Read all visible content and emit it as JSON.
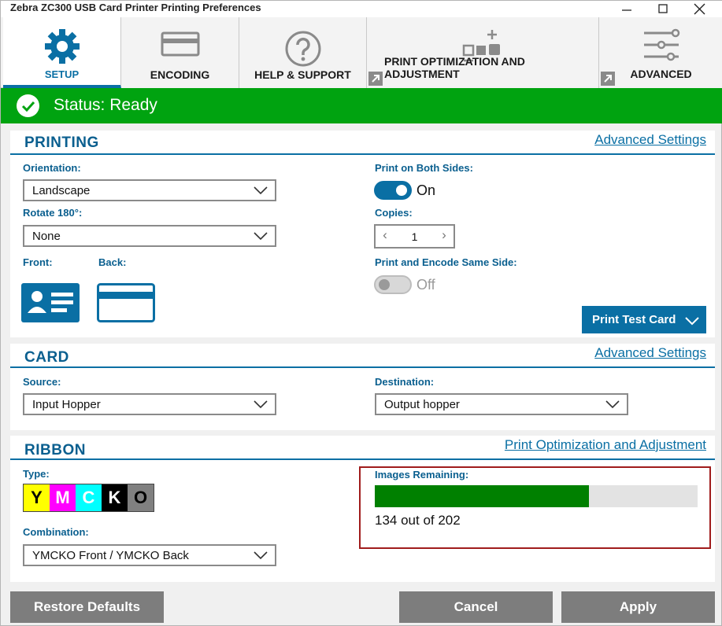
{
  "window": {
    "title": "Zebra ZC300 USB Card Printer Printing Preferences"
  },
  "tabs": [
    {
      "label": "SETUP",
      "icon": "gear-icon"
    },
    {
      "label": "ENCODING",
      "icon": "card-icon"
    },
    {
      "label": "HELP & SUPPORT",
      "icon": "question-icon"
    },
    {
      "label": "PRINT OPTIMIZATION AND ADJUSTMENT",
      "icon": "optimization-icon"
    },
    {
      "label": "ADVANCED",
      "icon": "sliders-icon"
    }
  ],
  "status": {
    "text": "Status: Ready",
    "color": "#00a310"
  },
  "printing": {
    "title": "PRINTING",
    "advanced_link": "Advanced Settings",
    "orientation_label": "Orientation:",
    "orientation_value": "Landscape",
    "rotate_label": "Rotate 180°:",
    "rotate_value": "None",
    "front_label": "Front:",
    "back_label": "Back:",
    "both_sides_label": "Print on Both Sides:",
    "both_sides_state": "On",
    "copies_label": "Copies:",
    "copies_value": "1",
    "encode_same_side_label": "Print and Encode Same Side:",
    "encode_same_side_state": "Off",
    "test_card_button": "Print Test Card"
  },
  "card": {
    "title": "CARD",
    "advanced_link": "Advanced Settings",
    "source_label": "Source:",
    "source_value": "Input Hopper",
    "destination_label": "Destination:",
    "destination_value": "Output hopper"
  },
  "ribbon": {
    "title": "RIBBON",
    "link": "Print Optimization and Adjustment",
    "type_label": "Type:",
    "panels": [
      {
        "letter": "Y",
        "color": "#ffff00"
      },
      {
        "letter": "M",
        "color": "#ff00ff"
      },
      {
        "letter": "C",
        "color": "#00ffff"
      },
      {
        "letter": "K",
        "color": "#000000"
      },
      {
        "letter": "O",
        "color": "#808080"
      }
    ],
    "combination_label": "Combination:",
    "combination_value": "YMCKO Front / YMCKO Back",
    "images_label": "Images Remaining:",
    "images_remaining": 134,
    "images_total": 202,
    "images_text": "134 out of 202"
  },
  "footer": {
    "restore_button": "Restore Defaults",
    "cancel_button": "Cancel",
    "apply_button": "Apply"
  },
  "colors": {
    "accent": "#0a6fa4",
    "status_green": "#00a310",
    "progress_green": "#008000"
  }
}
